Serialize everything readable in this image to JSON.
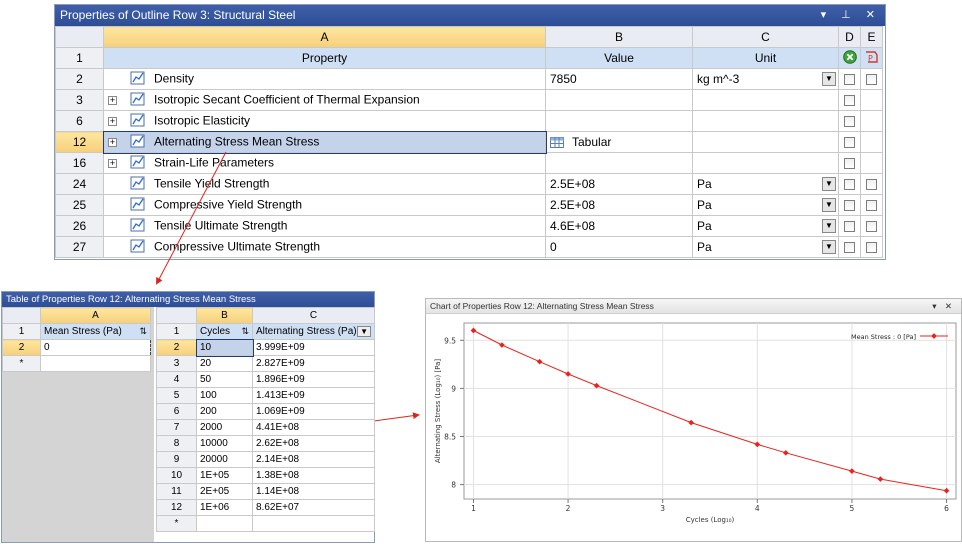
{
  "top_window": {
    "title": "Properties of Outline Row 3: Structural Steel",
    "col_letters": [
      "A",
      "B",
      "C",
      "D",
      "E"
    ],
    "header_row": {
      "num": "1",
      "property": "Property",
      "value": "Value",
      "unit": "Unit"
    },
    "rows": [
      {
        "num": "2",
        "name": "Density",
        "value": "7850",
        "unit": "kg m^-3",
        "expand": false,
        "dd": true,
        "chkD": true,
        "chkE": true
      },
      {
        "num": "3",
        "name": "Isotropic Secant Coefficient of Thermal Expansion",
        "value": "",
        "unit": "",
        "expand": true,
        "dd": false,
        "chkD": true,
        "chkE": false
      },
      {
        "num": "6",
        "name": "Isotropic Elasticity",
        "value": "",
        "unit": "",
        "expand": true,
        "dd": false,
        "chkD": true,
        "chkE": false
      },
      {
        "num": "12",
        "name": "Alternating Stress Mean Stress",
        "value": "Tabular",
        "unit": "",
        "expand": true,
        "dd": false,
        "chkD": true,
        "chkE": false
      },
      {
        "num": "16",
        "name": "Strain-Life Parameters",
        "value": "",
        "unit": "",
        "expand": true,
        "dd": false,
        "chkD": true,
        "chkE": false
      },
      {
        "num": "24",
        "name": "Tensile Yield Strength",
        "value": "2.5E+08",
        "unit": "Pa",
        "expand": false,
        "dd": true,
        "chkD": true,
        "chkE": true
      },
      {
        "num": "25",
        "name": "Compressive Yield Strength",
        "value": "2.5E+08",
        "unit": "Pa",
        "expand": false,
        "dd": true,
        "chkD": true,
        "chkE": true
      },
      {
        "num": "26",
        "name": "Tensile Ultimate Strength",
        "value": "4.6E+08",
        "unit": "Pa",
        "expand": false,
        "dd": true,
        "chkD": true,
        "chkE": true
      },
      {
        "num": "27",
        "name": "Compressive Ultimate Strength",
        "value": "0",
        "unit": "Pa",
        "expand": false,
        "dd": true,
        "chkD": true,
        "chkE": true
      }
    ]
  },
  "table_window": {
    "title": "Table of Properties Row 12: Alternating Stress Mean Stress",
    "left": {
      "col": "A",
      "header": "Mean Stress (Pa)",
      "rows": [
        {
          "num": "1"
        },
        {
          "num": "2",
          "val": "0"
        },
        {
          "num": "*",
          "val": ""
        }
      ]
    },
    "right": {
      "cols": [
        "B",
        "C"
      ],
      "header_b": "Cycles",
      "header_c": "Alternating Stress (Pa)",
      "rows": [
        {
          "num": "2",
          "b": "10",
          "c": "3.999E+09"
        },
        {
          "num": "3",
          "b": "20",
          "c": "2.827E+09"
        },
        {
          "num": "4",
          "b": "50",
          "c": "1.896E+09"
        },
        {
          "num": "5",
          "b": "100",
          "c": "1.413E+09"
        },
        {
          "num": "6",
          "b": "200",
          "c": "1.069E+09"
        },
        {
          "num": "7",
          "b": "2000",
          "c": "4.41E+08"
        },
        {
          "num": "8",
          "b": "10000",
          "c": "2.62E+08"
        },
        {
          "num": "9",
          "b": "20000",
          "c": "2.14E+08"
        },
        {
          "num": "10",
          "b": "1E+05",
          "c": "1.38E+08"
        },
        {
          "num": "11",
          "b": "2E+05",
          "c": "1.14E+08"
        },
        {
          "num": "12",
          "b": "1E+06",
          "c": "8.62E+07"
        },
        {
          "num": "*",
          "b": "",
          "c": ""
        }
      ]
    }
  },
  "chart_window": {
    "title": "Chart of Properties Row 12: Alternating Stress Mean Stress",
    "controls": "▾ ✕",
    "legend": "Mean Stress : 0 [Pa]",
    "xlabel": "Cycles  (Log₁₀)",
    "ylabel": "Alternating Stress  (Log₁₀)  [Pa]"
  },
  "chart_data": {
    "type": "line",
    "x": [
      1,
      1.301,
      1.699,
      2,
      2.301,
      3.301,
      4,
      4.301,
      5,
      5.301,
      6
    ],
    "y": [
      9.602,
      9.451,
      9.278,
      9.15,
      9.029,
      8.644,
      8.418,
      8.33,
      8.14,
      8.057,
      7.936
    ],
    "xticks": [
      "1",
      "2",
      "3",
      "4",
      "5",
      "6"
    ],
    "yticks": [
      "8",
      "8.5",
      "9",
      "9.5"
    ],
    "xlim": [
      0.9,
      6.1
    ],
    "ylim": [
      7.85,
      9.68
    ],
    "series_color": "#e8231f",
    "legend_position": "top-right",
    "grid": true
  }
}
